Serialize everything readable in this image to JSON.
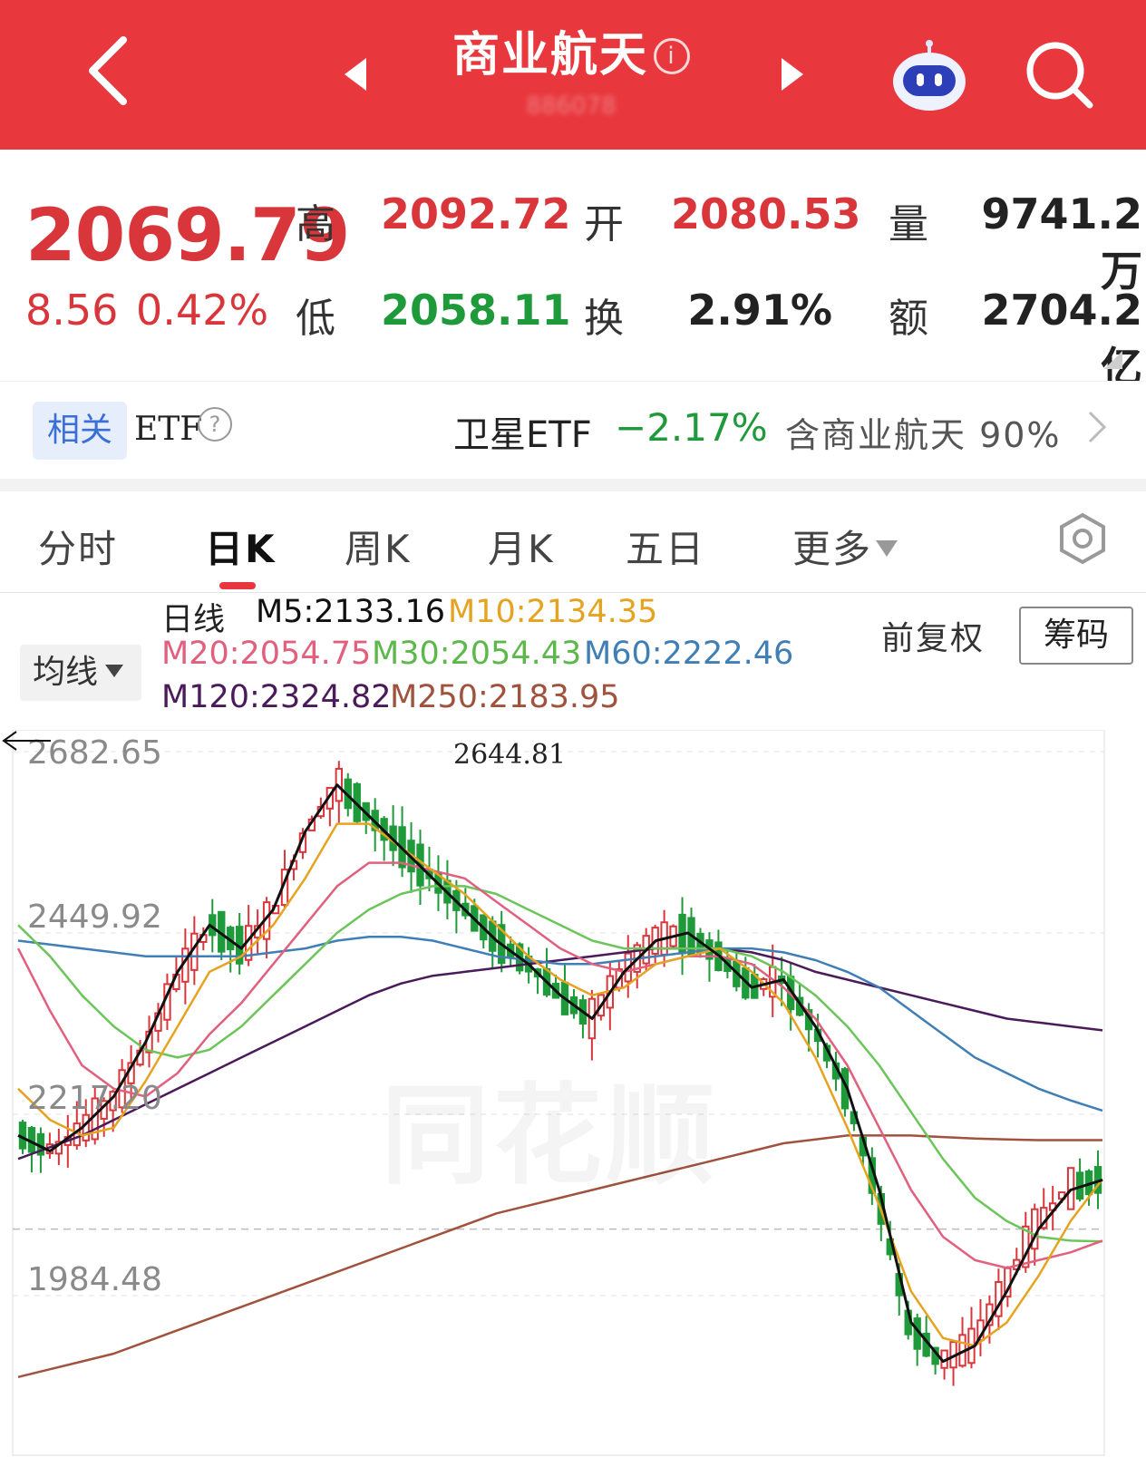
{
  "header": {
    "title": "商业航天",
    "info_icon": "info-icon",
    "subtitle": "886078"
  },
  "quote": {
    "price": "2069.79",
    "change": "8.56",
    "change_pct": "0.42%",
    "high_label": "高",
    "high": "2092.72",
    "low_label": "低",
    "low": "2058.11",
    "open_label": "开",
    "open": "2080.53",
    "turnover_label": "换",
    "turnover": "2.91%",
    "volume_label": "量",
    "volume": "9741.2万",
    "amount_label": "额",
    "amount": "2704.2亿"
  },
  "etf": {
    "related_label": "相关",
    "etf_label": "ETF",
    "help_icon": "?",
    "name": "卫星ETF",
    "change_pct": "−2.17%",
    "contains": "含商业航天 90%"
  },
  "tabs": {
    "items": [
      "分时",
      "日K",
      "周K",
      "月K",
      "五日",
      "更多"
    ],
    "active": "日K"
  },
  "legend": {
    "ma_dropdown": "均线",
    "line_label": "日线",
    "m5": "M5:2133.16",
    "m10": "M10:2134.35",
    "m20": "M20:2054.75",
    "m30": "M30:2054.43",
    "m60": "M60:2222.46",
    "m120": "M120:2324.82",
    "m250": "M250:2183.95",
    "adjust": "前复权",
    "chips_button": "筹码"
  },
  "colors": {
    "header_red": "#e8383d",
    "up_red": "#d9363b",
    "down_green": "#1f9a3a",
    "m5": "#111111",
    "m10": "#e6a321",
    "m20": "#e0607e",
    "m30": "#6cc55a",
    "m60": "#3f7fb5",
    "m120": "#4a1a5a",
    "m250": "#a0523d"
  },
  "chart_data": {
    "type": "candlestick",
    "y_ticks": [
      "2682.65",
      "2449.92",
      "2217.20",
      "1984.48"
    ],
    "ylim": [
      1984.48,
      2682.65
    ],
    "annotation": "2644.81",
    "watermark": "同花顺",
    "series": [
      {
        "name": "M5",
        "values": [
          2190,
          2170,
          2200,
          2240,
          2310,
          2400,
          2460,
          2430,
          2480,
          2580,
          2640,
          2600,
          2560,
          2520,
          2480,
          2440,
          2410,
          2370,
          2340,
          2400,
          2440,
          2450,
          2420,
          2380,
          2390,
          2330,
          2250,
          2120,
          1950,
          1900,
          1920,
          1990,
          2070,
          2120,
          2133
        ]
      },
      {
        "name": "M10",
        "values": [
          2250,
          2210,
          2190,
          2200,
          2260,
          2330,
          2400,
          2420,
          2460,
          2520,
          2590,
          2590,
          2560,
          2530,
          2500,
          2460,
          2420,
          2390,
          2370,
          2380,
          2410,
          2420,
          2430,
          2400,
          2360,
          2290,
          2200,
          2100,
          1990,
          1930,
          1920,
          1950,
          2010,
          2080,
          2134
        ]
      },
      {
        "name": "M20",
        "values": [
          2430,
          2350,
          2280,
          2250,
          2240,
          2270,
          2320,
          2360,
          2410,
          2460,
          2510,
          2540,
          2540,
          2530,
          2520,
          2490,
          2460,
          2430,
          2410,
          2400,
          2410,
          2420,
          2420,
          2410,
          2380,
          2340,
          2280,
          2200,
          2120,
          2060,
          2030,
          2020,
          2030,
          2040,
          2055
        ]
      },
      {
        "name": "M30",
        "values": [
          2460,
          2420,
          2370,
          2330,
          2300,
          2290,
          2300,
          2330,
          2370,
          2410,
          2450,
          2480,
          2500,
          2510,
          2510,
          2500,
          2480,
          2460,
          2440,
          2430,
          2430,
          2430,
          2430,
          2420,
          2400,
          2370,
          2330,
          2280,
          2220,
          2160,
          2110,
          2080,
          2060,
          2055,
          2054
        ]
      },
      {
        "name": "M60",
        "values": [
          2440,
          2435,
          2430,
          2425,
          2420,
          2420,
          2420,
          2420,
          2425,
          2430,
          2440,
          2445,
          2445,
          2440,
          2430,
          2420,
          2415,
          2410,
          2410,
          2415,
          2420,
          2425,
          2430,
          2430,
          2425,
          2415,
          2400,
          2380,
          2350,
          2320,
          2290,
          2270,
          2250,
          2235,
          2222
        ]
      },
      {
        "name": "M120",
        "values": [
          2160,
          2175,
          2190,
          2210,
          2230,
          2250,
          2270,
          2290,
          2310,
          2330,
          2350,
          2370,
          2385,
          2395,
          2400,
          2405,
          2410,
          2415,
          2420,
          2425,
          2430,
          2430,
          2430,
          2425,
          2415,
          2400,
          2390,
          2380,
          2370,
          2360,
          2350,
          2340,
          2335,
          2330,
          2325
        ]
      },
      {
        "name": "M250",
        "values": [
          1880,
          1890,
          1900,
          1910,
          1925,
          1940,
          1955,
          1970,
          1985,
          2000,
          2015,
          2030,
          2045,
          2060,
          2075,
          2090,
          2100,
          2110,
          2120,
          2130,
          2140,
          2150,
          2160,
          2170,
          2180,
          2185,
          2190,
          2190,
          2190,
          2188,
          2186,
          2185,
          2184,
          2184,
          2184
        ]
      }
    ]
  }
}
